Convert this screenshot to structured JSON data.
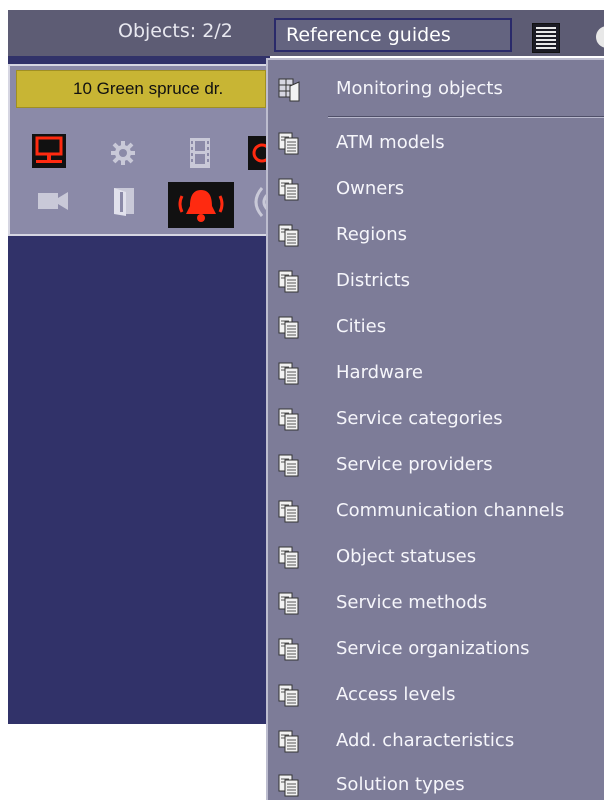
{
  "topbar": {
    "objects_label": "Objects: 2/2",
    "reference_guides_button": "Reference guides"
  },
  "object_card": {
    "name": "10 Green spruce dr."
  },
  "menu": {
    "items": [
      {
        "label": "Monitoring objects",
        "icon": "grid-document-icon"
      },
      {
        "label": "ATM models",
        "icon": "documents-icon"
      },
      {
        "label": "Owners",
        "icon": "documents-icon"
      },
      {
        "label": "Regions",
        "icon": "documents-icon"
      },
      {
        "label": "Districts",
        "icon": "documents-icon"
      },
      {
        "label": "Cities",
        "icon": "documents-icon"
      },
      {
        "label": "Hardware",
        "icon": "documents-icon"
      },
      {
        "label": "Service categories",
        "icon": "documents-icon"
      },
      {
        "label": "Service providers",
        "icon": "documents-icon"
      },
      {
        "label": "Communication channels",
        "icon": "documents-icon"
      },
      {
        "label": "Object statuses",
        "icon": "documents-icon"
      },
      {
        "label": "Service methods",
        "icon": "documents-icon"
      },
      {
        "label": "Service organizations",
        "icon": "documents-icon"
      },
      {
        "label": "Access levels",
        "icon": "documents-icon"
      },
      {
        "label": "Add. characteristics",
        "icon": "documents-icon"
      },
      {
        "label": "Solution types",
        "icon": "documents-icon"
      }
    ]
  },
  "colors": {
    "menu_bg": "#7d7c98",
    "topbar_bg": "#5d5c74",
    "panel_bg": "#313269",
    "card_name_bg": "#c8b534",
    "alarm_red": "#ff2a10"
  }
}
